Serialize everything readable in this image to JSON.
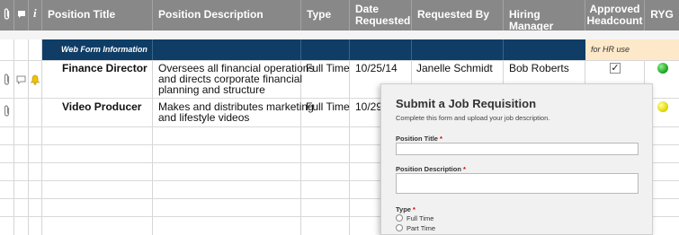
{
  "columns": {
    "position_title": "Position Title",
    "position_description": "Position Description",
    "type": "Type",
    "date_requested_1": "Date",
    "date_requested_2": "Requested",
    "requested_by": "Requested By",
    "hiring_manager": "Hiring Manager",
    "approved_headcount_1": "Approved",
    "approved_headcount_2": "Headcount",
    "ryg": "RYG",
    "info_icon_label": "i"
  },
  "section": {
    "label": "Web Form Information",
    "hr_label": "for HR use"
  },
  "rows": [
    {
      "position_title": "Finance Director",
      "description": [
        "Oversees all financial operations",
        "and directs corporate financial",
        "planning and structure"
      ],
      "type": "Full Time",
      "date_requested": "10/25/14",
      "requested_by": "Janelle Schmidt",
      "hiring_manager": "Bob Roberts",
      "approved": true,
      "approved_mark": "✓",
      "ryg": "green",
      "has_attachment": true,
      "has_comment": true,
      "has_alert": true
    },
    {
      "position_title": "Video Producer",
      "description": [
        "Makes and distributes marketing",
        "and lifestyle videos"
      ],
      "type": "Full Time",
      "date_requested": "10/29/",
      "ryg": "yellow",
      "has_attachment": true
    }
  ],
  "form": {
    "title": "Submit a Job Requisition",
    "subtitle": "Complete this form and upload your job description.",
    "required_marker": "*",
    "fields": {
      "position_title": "Position Title",
      "position_description": "Position Description",
      "type": "Type"
    },
    "type_options": [
      "Full Time",
      "Part Time"
    ]
  },
  "colors": {
    "header": "#888888",
    "section": "#0f3d66",
    "hr_section": "#fde9c9",
    "ryg_green": "#1ea51e",
    "ryg_yellow": "#e1d800"
  },
  "icons": [
    "paperclip-icon",
    "comment-icon",
    "info-icon",
    "bell-icon"
  ]
}
